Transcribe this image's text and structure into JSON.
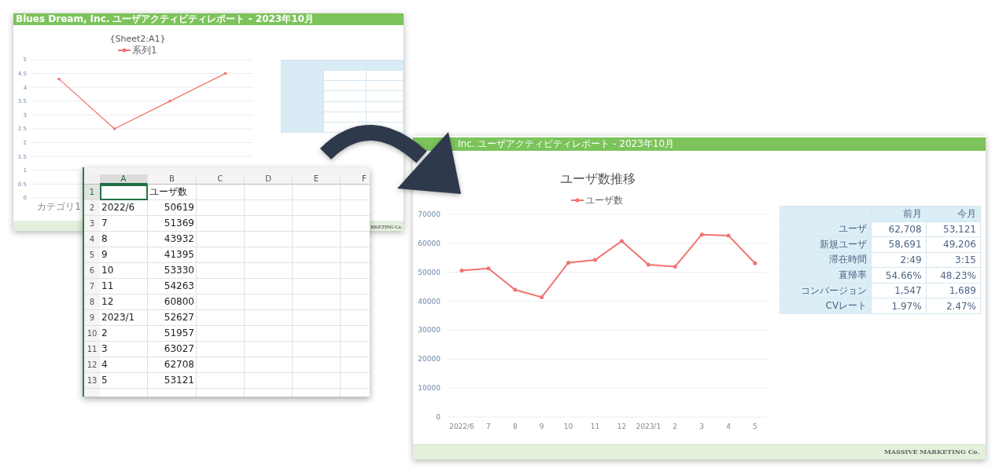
{
  "old_report": {
    "header": "Blues Dream, Inc. ユーザアクティビティレポート - 2023年10月",
    "chart_data": {
      "type": "line",
      "title": "{Sheet2:A1}",
      "grid": true,
      "categories": [
        "カテゴリ1",
        null,
        null,
        null
      ],
      "series": [
        {
          "name": "系列1",
          "color": "#f07470",
          "values": [
            4.3,
            2.5,
            3.5,
            4.5
          ]
        }
      ],
      "ylim": [
        0,
        5
      ],
      "yticks": [
        0,
        0.5,
        1,
        1.5,
        2,
        2.5,
        3,
        3.5,
        4,
        4.5,
        5
      ]
    },
    "footer": "RKETING Co."
  },
  "spreadsheet": {
    "columns": [
      {
        "label": "A",
        "selected": true
      },
      {
        "label": "B",
        "selected": false
      },
      {
        "label": "C",
        "selected": false
      },
      {
        "label": "D",
        "selected": false
      },
      {
        "label": "E",
        "selected": false
      },
      {
        "label": "F",
        "selected": false
      }
    ],
    "rows": [
      {
        "number": "1",
        "selected": true,
        "cells": [
          {
            "kind": "empty"
          },
          {
            "kind": "text",
            "value": "ユーザ数"
          }
        ]
      },
      {
        "number": "2",
        "selected": false,
        "cells": [
          {
            "kind": "text",
            "value": "2022/6"
          },
          {
            "kind": "number",
            "value": "50619"
          }
        ]
      },
      {
        "number": "3",
        "selected": false,
        "cells": [
          {
            "kind": "text",
            "value": "7"
          },
          {
            "kind": "number",
            "value": "51369"
          }
        ]
      },
      {
        "number": "4",
        "selected": false,
        "cells": [
          {
            "kind": "text",
            "value": "8"
          },
          {
            "kind": "number",
            "value": "43932"
          }
        ]
      },
      {
        "number": "5",
        "selected": false,
        "cells": [
          {
            "kind": "text",
            "value": "9"
          },
          {
            "kind": "number",
            "value": "41395"
          }
        ]
      },
      {
        "number": "6",
        "selected": false,
        "cells": [
          {
            "kind": "text",
            "value": "10"
          },
          {
            "kind": "number",
            "value": "53330"
          }
        ]
      },
      {
        "number": "7",
        "selected": false,
        "cells": [
          {
            "kind": "text",
            "value": "11"
          },
          {
            "kind": "number",
            "value": "54263"
          }
        ]
      },
      {
        "number": "8",
        "selected": false,
        "cells": [
          {
            "kind": "text",
            "value": "12"
          },
          {
            "kind": "number",
            "value": "60800"
          }
        ]
      },
      {
        "number": "9",
        "selected": false,
        "cells": [
          {
            "kind": "text",
            "value": "2023/1"
          },
          {
            "kind": "number",
            "value": "52627"
          }
        ]
      },
      {
        "number": "10",
        "selected": false,
        "cells": [
          {
            "kind": "text",
            "value": "2"
          },
          {
            "kind": "number",
            "value": "51957"
          }
        ]
      },
      {
        "number": "11",
        "selected": false,
        "cells": [
          {
            "kind": "text",
            "value": "3"
          },
          {
            "kind": "number",
            "value": "63027"
          }
        ]
      },
      {
        "number": "12",
        "selected": false,
        "cells": [
          {
            "kind": "text",
            "value": "4"
          },
          {
            "kind": "number",
            "value": "62708"
          }
        ]
      },
      {
        "number": "13",
        "selected": false,
        "cells": [
          {
            "kind": "text",
            "value": "5"
          },
          {
            "kind": "number",
            "value": "53121"
          }
        ]
      }
    ]
  },
  "new_report": {
    "header": "Inc. ユーザアクティビティレポート - 2023年10月",
    "chart_data": {
      "type": "line",
      "title": "ユーザ数推移",
      "grid": true,
      "categories": [
        "2022/6",
        "7",
        "8",
        "9",
        "10",
        "11",
        "12",
        "2023/1",
        "2",
        "3",
        "4",
        "5"
      ],
      "series": [
        {
          "name": "ユーザ数",
          "color": "#f07470",
          "values": [
            50619,
            51369,
            43932,
            41395,
            53330,
            54263,
            60800,
            52627,
            51957,
            63027,
            62708,
            53121
          ]
        }
      ],
      "ylim": [
        0,
        70000
      ],
      "yticks": [
        0,
        10000,
        20000,
        30000,
        40000,
        50000,
        60000,
        70000
      ]
    },
    "table": {
      "columns": [
        "前月",
        "今月"
      ],
      "rows": [
        {
          "label": "ユーザ",
          "values": [
            "62,708",
            "53,121"
          ]
        },
        {
          "label": "新規ユーザ",
          "values": [
            "58,691",
            "49,206"
          ]
        },
        {
          "label": "滞在時間",
          "values": [
            "2:49",
            "3:15"
          ]
        },
        {
          "label": "直帰率",
          "values": [
            "54.66%",
            "48.23%"
          ]
        },
        {
          "label": "コンバージョン",
          "values": [
            "1,547",
            "1,689"
          ]
        },
        {
          "label": "CVレート",
          "values": [
            "1.97%",
            "2.47%"
          ]
        }
      ]
    },
    "footer": "MASSIVE MARKETING Co."
  }
}
